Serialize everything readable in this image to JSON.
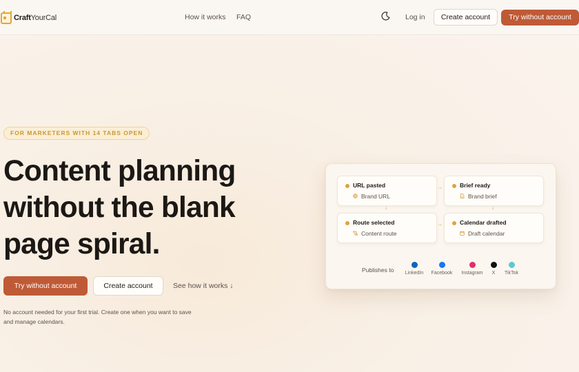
{
  "brand": {
    "name_bold": "Craft",
    "name_rest": "YourCal",
    "accent": "#e7a52c"
  },
  "nav": {
    "links": [
      "How it works",
      "FAQ"
    ],
    "theme_icon": "moon-icon",
    "login": "Log in",
    "create_account": "Create account",
    "try_without": "Try without account"
  },
  "hero": {
    "eyebrow": "FOR MARKETERS WITH 14 TABS OPEN",
    "headline": [
      "Content planning",
      "without the blank",
      "page spiral."
    ],
    "primary_cta": "Try without account",
    "secondary_cta": "Create account",
    "see_how": "See how it works ↓",
    "note": "No account needed for your first trial. Create one when you want to save and manage calendars."
  },
  "flow": {
    "steps": [
      {
        "title": "URL pasted",
        "sub": "Brand URL",
        "icon": "globe-icon"
      },
      {
        "title": "Brief ready",
        "sub": "Brand brief",
        "icon": "document-icon"
      },
      {
        "title": "Route selected",
        "sub": "Content route",
        "icon": "route-icon"
      },
      {
        "title": "Calendar drafted",
        "sub": "Draft calendar",
        "icon": "calendar-icon"
      }
    ],
    "publishes_label": "Publishes to",
    "channels": [
      {
        "name": "LinkedIn",
        "color": "#0a66c2"
      },
      {
        "name": "Facebook",
        "color": "#1877f2"
      },
      {
        "name": "Instagram",
        "color": "#e1306c"
      },
      {
        "name": "X",
        "color": "#111111"
      },
      {
        "name": "TikTok",
        "color": "#5cc9d2"
      }
    ]
  },
  "colors": {
    "primary": "#bf5a36",
    "dot": "#e1a33a"
  }
}
